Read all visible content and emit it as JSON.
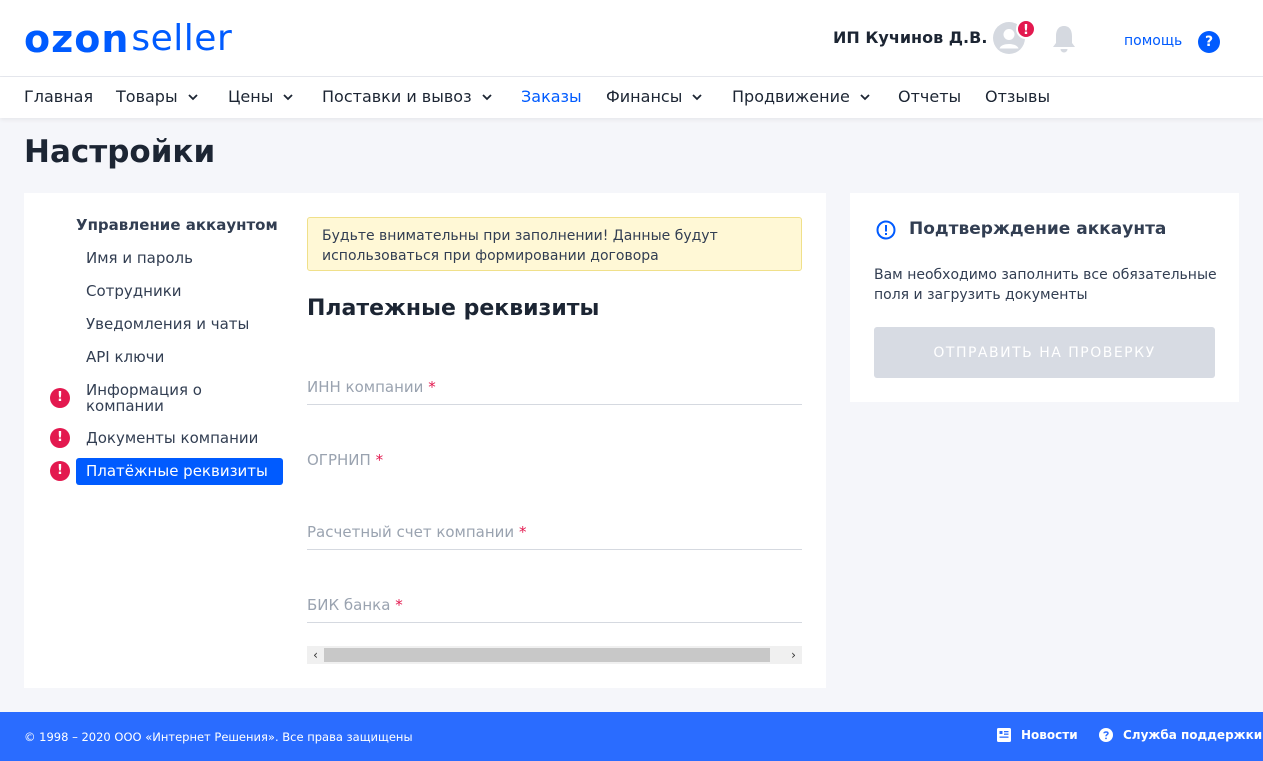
{
  "brand": {
    "logo_main": "ozon",
    "logo_sub": "seller",
    "color": "#005bff"
  },
  "header": {
    "user_name": "ИП Кучинов Д.В.",
    "avatar_badge": "!",
    "help_label": "помощь",
    "help_icon_text": "?"
  },
  "nav": {
    "items": [
      {
        "label": "Главная",
        "dropdown": false
      },
      {
        "label": "Товары",
        "dropdown": true
      },
      {
        "label": "Цены",
        "dropdown": true
      },
      {
        "label": "Поставки и вывоз",
        "dropdown": true
      },
      {
        "label": "Заказы",
        "dropdown": false,
        "active": true
      },
      {
        "label": "Финансы",
        "dropdown": true
      },
      {
        "label": "Продвижение",
        "dropdown": true
      },
      {
        "label": "Отчеты",
        "dropdown": false
      },
      {
        "label": "Отзывы",
        "dropdown": false
      }
    ]
  },
  "page": {
    "title": "Настройки"
  },
  "settings_menu": {
    "heading": "Управление аккаунтом",
    "items": [
      {
        "label": "Имя и пароль",
        "warning": false
      },
      {
        "label": "Сотрудники",
        "warning": false
      },
      {
        "label": "Уведомления и чаты",
        "warning": false
      },
      {
        "label": "API ключи",
        "warning": false
      },
      {
        "label": "Информация о компании",
        "warning": true
      },
      {
        "label": "Документы компании",
        "warning": true
      },
      {
        "label": "Платёжные реквизиты",
        "warning": true,
        "selected": true
      }
    ],
    "warning_glyph": "!"
  },
  "form": {
    "notice": "Будьте внимательны при заполнении! Данные будут использоваться при формировании договора",
    "title": "Платежные реквизиты",
    "required_mark": "*",
    "fields": [
      {
        "label": "ИНН компании"
      },
      {
        "label": "ОГРНИП"
      },
      {
        "label": "Расчетный счет компании"
      },
      {
        "label": "БИК банка"
      }
    ],
    "scroll_left": "‹",
    "scroll_right": "›"
  },
  "verification": {
    "title": "Подтверждение аккаунта",
    "text": "Вам необходимо заполнить все обязательные поля и загрузить документы",
    "button": "ОТПРАВИТЬ НА ПРОВЕРКУ"
  },
  "footer": {
    "copyright": "© 1998 – 2020 ООО «Интернет Решения». Все права защищены",
    "news": "Новости",
    "support": "Служба поддержки"
  },
  "colors": {
    "accent": "#005bff",
    "warning": "#e3194f",
    "notice_bg": "#fff8d6",
    "footer_bg": "#2a6cff"
  }
}
